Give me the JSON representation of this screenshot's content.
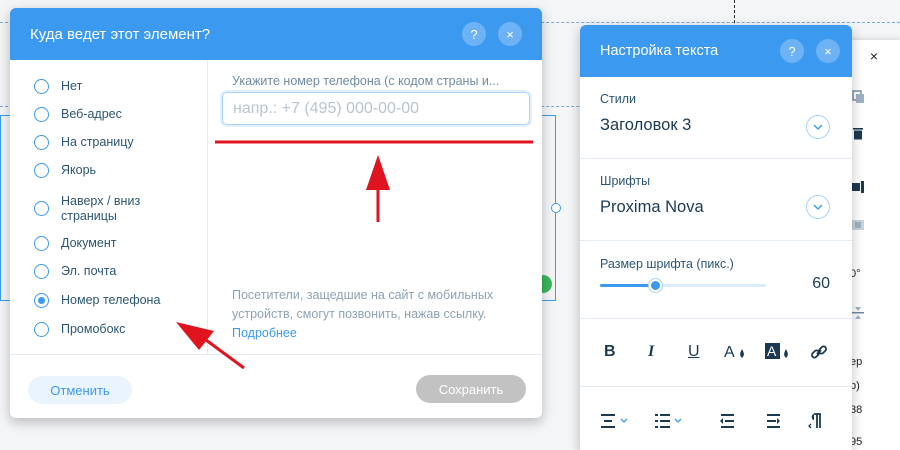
{
  "background": {
    "side_panel": {
      "close": "×",
      "texts": [
        "0°",
        "ер",
        "р)",
        "38",
        "95"
      ]
    }
  },
  "link_dialog": {
    "title": "Куда ведет этот элемент?",
    "help_label": "?",
    "close_label": "×",
    "options": [
      {
        "label": "Нет",
        "checked": false
      },
      {
        "label": "Веб-адрес",
        "checked": false
      },
      {
        "label": "На страницу",
        "checked": false
      },
      {
        "label": "Якорь",
        "checked": false
      },
      {
        "label": "Наверх / вниз страницы",
        "checked": false
      },
      {
        "label": "Документ",
        "checked": false
      },
      {
        "label": "Эл. почта",
        "checked": false
      },
      {
        "label": "Номер телефона",
        "checked": true
      },
      {
        "label": "Промобокс",
        "checked": false
      }
    ],
    "phone_field": {
      "label": "Укажите номер телефона (с кодом страны и...",
      "value": "",
      "placeholder": "напр.: +7 (495) 000-00-00"
    },
    "help_text": "Посетители, защедшие на сайт с мобильных устройств, смогут позвонить, нажав ссылку.",
    "help_link": "Подробнее",
    "cancel_label": "Отменить",
    "save_label": "Сохранить"
  },
  "text_settings": {
    "title": "Настройка текста",
    "help_label": "?",
    "close_label": "×",
    "styles_label": "Стили",
    "styles_value": "Заголовок 3",
    "fonts_label": "Шрифты",
    "fonts_value": "Proxima Nova",
    "size_label": "Размер шрифта (пикс.)",
    "size_value": "60",
    "size_fraction": 0.33,
    "format_buttons": [
      "B",
      "I",
      "U"
    ]
  },
  "colors": {
    "accent": "#3c99f0",
    "annotation": "#e0141e"
  }
}
